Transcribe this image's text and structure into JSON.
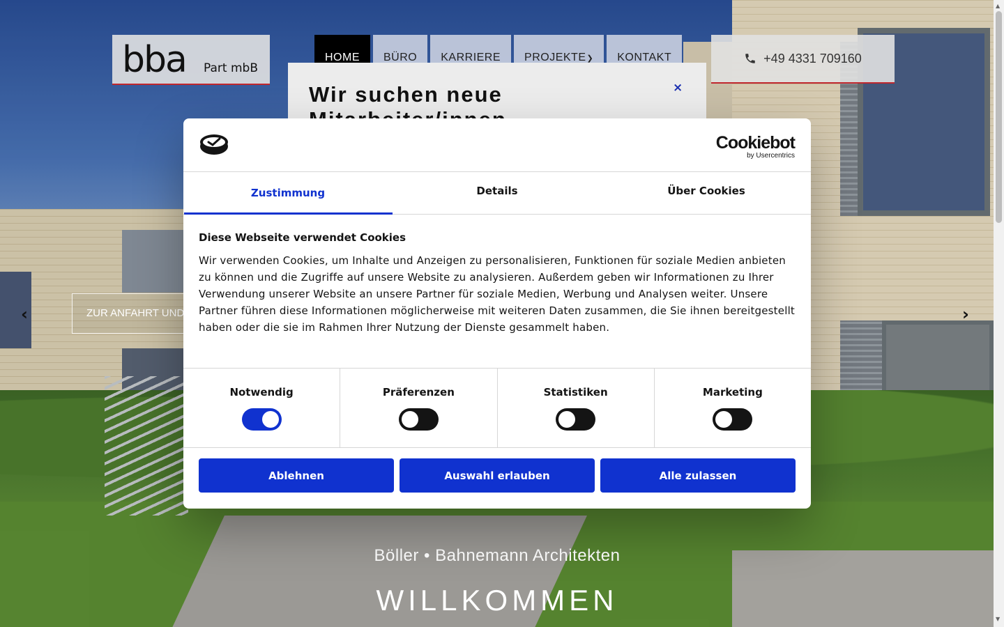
{
  "header": {
    "logo_main": "bba",
    "logo_sub": "Part mbB",
    "nav": [
      {
        "label": "HOME",
        "active": true
      },
      {
        "label": "BÜRO"
      },
      {
        "label": "KARRIERE"
      },
      {
        "label": "PROJEKTE",
        "dropdown": true
      },
      {
        "label": "KONTAKT"
      }
    ],
    "phone": "+49 4331 709160",
    "phone_icon": "phone-icon"
  },
  "job_popup": {
    "title": "Wir suchen neue Mitarbeiter/innen",
    "close_label": "×"
  },
  "slider": {
    "route_button": "ZUR ANFAHRT UND",
    "prev_arrow": "‹",
    "next_arrow": "›",
    "tagline": "Böller • Bahnemann Architekten",
    "welcome": "WILLKOMMEN"
  },
  "cookie": {
    "brand_main": "Cookiebot",
    "brand_sub": "by Usercentrics",
    "tabs": [
      {
        "label": "Zustimmung",
        "active": true
      },
      {
        "label": "Details"
      },
      {
        "label": "Über Cookies"
      }
    ],
    "heading": "Diese Webseite verwendet Cookies",
    "text": "Wir verwenden Cookies, um Inhalte und Anzeigen zu personalisieren, Funktionen für soziale Medien anbieten zu können und die Zugriffe auf unsere Website zu analysieren. Außerdem geben wir Informationen zu Ihrer Verwendung unserer Website an unsere Partner für soziale Medien, Werbung und Analysen weiter. Unsere Partner führen diese Informationen möglicherweise mit weiteren Daten zusammen, die Sie ihnen bereitgestellt haben oder die sie im Rahmen Ihrer Nutzung der Dienste gesammelt haben.",
    "toggles": [
      {
        "label": "Notwendig",
        "on": true
      },
      {
        "label": "Präferenzen",
        "on": false
      },
      {
        "label": "Statistiken",
        "on": false
      },
      {
        "label": "Marketing",
        "on": false
      }
    ],
    "buttons": {
      "deny": "Ablehnen",
      "allow_selection": "Auswahl erlauben",
      "allow_all": "Alle zulassen"
    },
    "accent_color": "#1032cf"
  }
}
